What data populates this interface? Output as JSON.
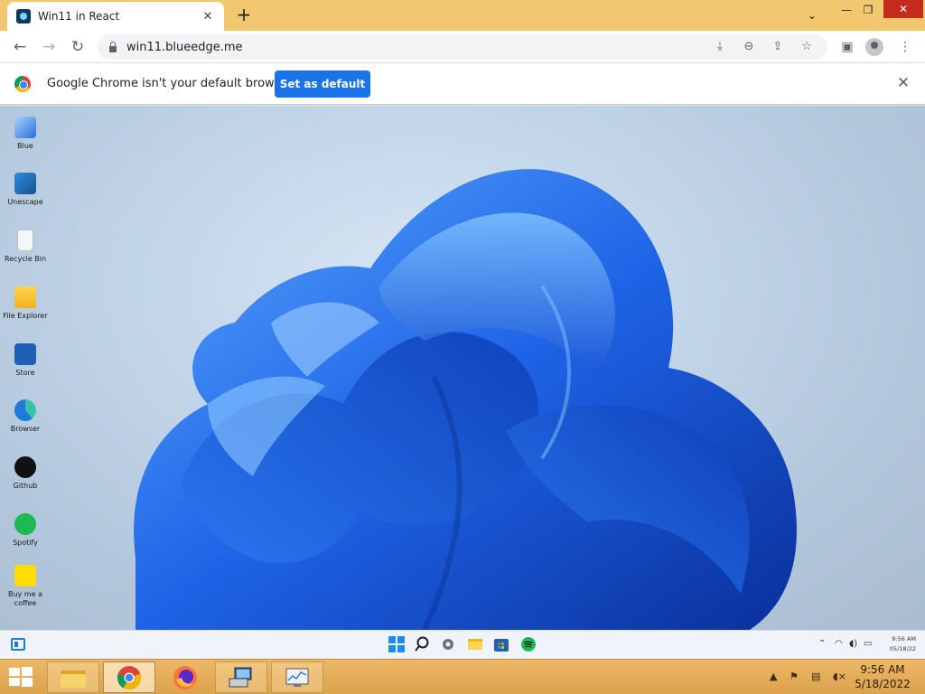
{
  "browser": {
    "tab_title": "Win11 in React",
    "new_tab": "+",
    "url": "win11.blueedge.me",
    "window": {
      "minimize": "—",
      "maximize": "❐",
      "close": "✕",
      "tab_search": "⌄"
    }
  },
  "infobar": {
    "message": "Google Chrome isn't your default browser",
    "button": "Set as default",
    "close": "✕"
  },
  "desktop": {
    "icons": [
      {
        "label": "Blue",
        "icon": "blue-icon"
      },
      {
        "label": "Unescape",
        "icon": "unescape-icon"
      },
      {
        "label": "Recycle Bin",
        "icon": "recycle-bin-icon"
      },
      {
        "label": "File Explorer",
        "icon": "folder-icon"
      },
      {
        "label": "Store",
        "icon": "store-icon"
      },
      {
        "label": "Browser",
        "icon": "edge-icon"
      },
      {
        "label": "Github",
        "icon": "github-icon"
      },
      {
        "label": "Spotify",
        "icon": "spotify-icon"
      },
      {
        "label": "Buy me a coffee",
        "icon": "coffee-icon"
      }
    ]
  },
  "win11_taskbar": {
    "time": "9:56 AM",
    "date": "05/18/22"
  },
  "host_taskbar": {
    "time": "9:56 AM",
    "date": "5/18/2022"
  },
  "colors": {
    "chrome_frame": "#f1c870",
    "accent_blue": "#1a73e8",
    "wallpaper_bloom": "#1e63e6",
    "host_taskbar": "#dca24d"
  }
}
